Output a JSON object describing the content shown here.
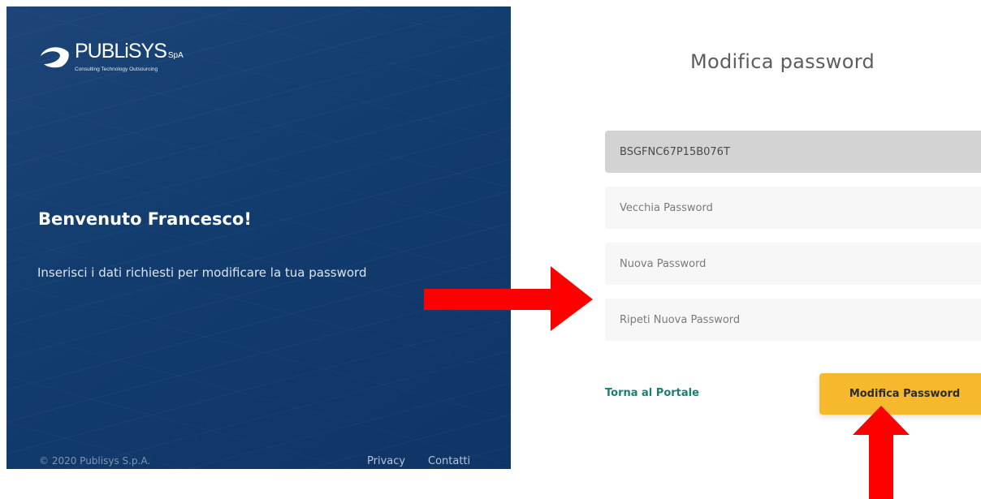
{
  "branding": {
    "name": "PUBLiSYS",
    "suffix": "SpA",
    "tagline": "Consulting Technology Outsourcing"
  },
  "left": {
    "welcome": "Benvenuto Francesco!",
    "subtitle": "Inserisci i dati richiesti per modificare la tua password",
    "copyright": "© 2020 Publisys S.p.A.",
    "privacy": "Privacy",
    "contacts": "Contatti"
  },
  "form": {
    "title": "Modifica password",
    "fiscal_code": "BSGFNC67P15B076T",
    "old_password_placeholder": "Vecchia Password",
    "new_password_placeholder": "Nuova Password",
    "repeat_password_placeholder": "Ripeti Nuova Password",
    "back_link": "Torna al Portale",
    "submit": "Modifica Password"
  },
  "colors": {
    "panel": "#123c6e",
    "accent_button": "#f6b92d",
    "link": "#1b7d74",
    "annotation_arrow": "#ff0000"
  },
  "annotations": [
    "arrow-right-icon",
    "arrow-up-icon"
  ]
}
